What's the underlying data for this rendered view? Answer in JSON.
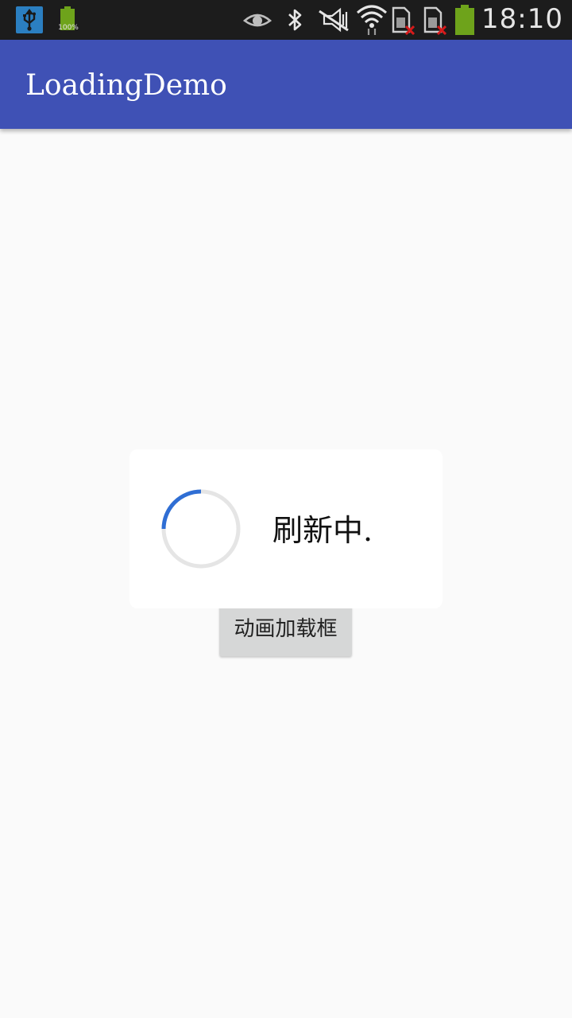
{
  "status_bar": {
    "battery_small_label": "100%",
    "time": "18:10",
    "icons": [
      "usb-icon",
      "battery-full-icon",
      "eye-icon",
      "bluetooth-icon",
      "signal-muted-icon",
      "wifi-icon",
      "sim-card-error-icon",
      "sim-card-error-icon",
      "battery-icon"
    ],
    "icon_color": "#e6e6e6",
    "battery_color": "#6ea31b",
    "error_color": "#d61a1a"
  },
  "app_bar": {
    "title": "LoadingDemo",
    "color": "#3f51b5"
  },
  "main": {
    "button_label": "动画加载框"
  },
  "dialog": {
    "message": "刷新中.",
    "spinner_color": "#2f6ed4",
    "spinner_track_color": "#e5e5e5"
  }
}
